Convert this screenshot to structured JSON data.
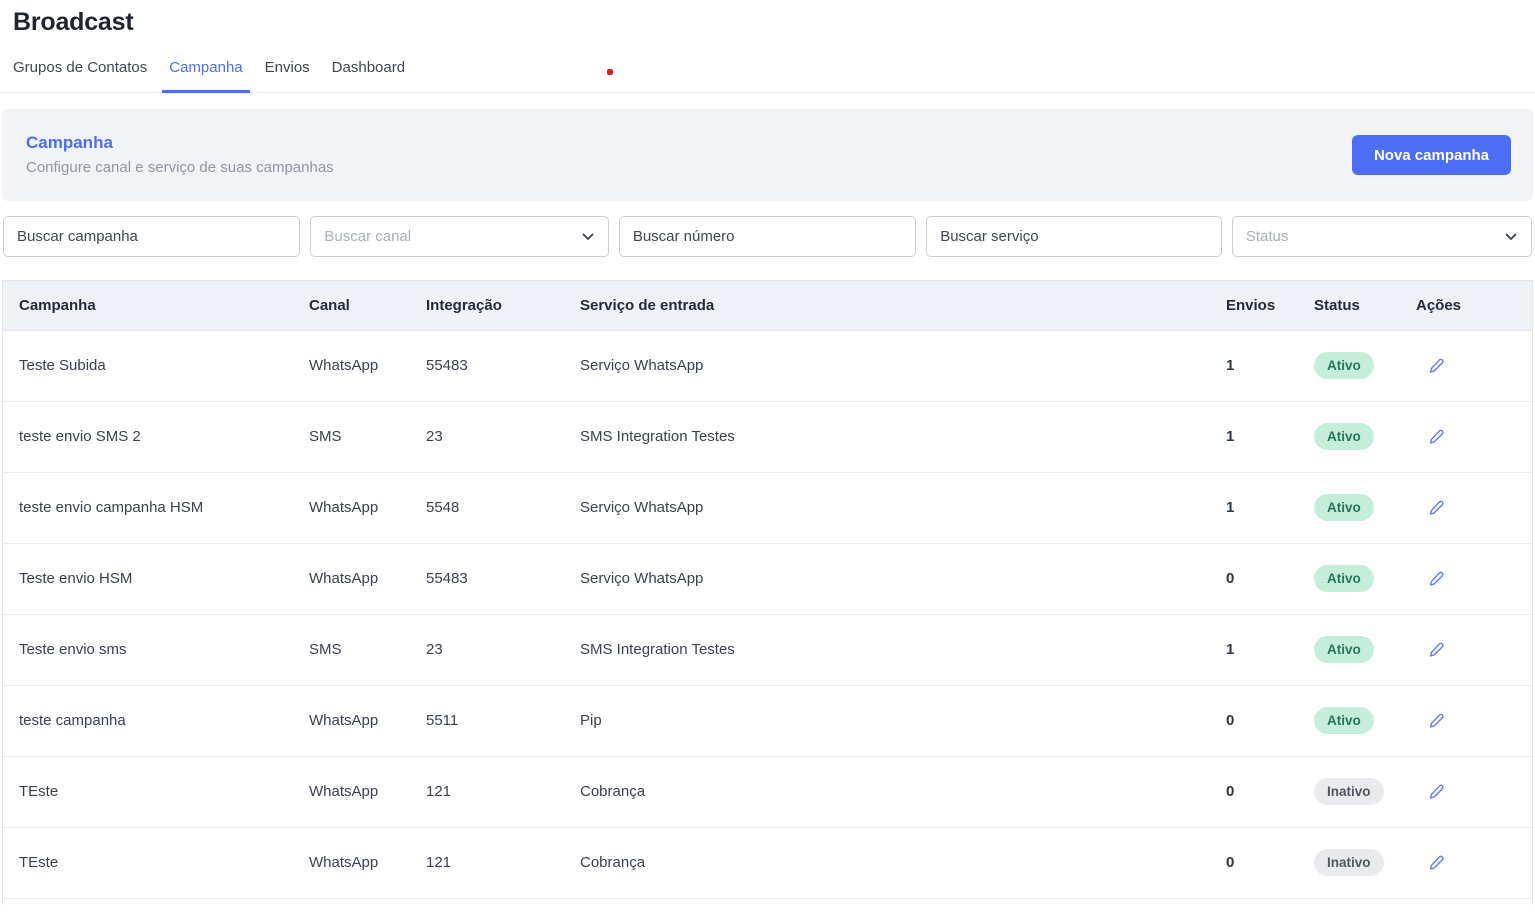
{
  "page": {
    "title": "Broadcast"
  },
  "tabs": [
    {
      "label": "Grupos de Contatos",
      "active": false
    },
    {
      "label": "Campanha",
      "active": true
    },
    {
      "label": "Envios",
      "active": false
    },
    {
      "label": "Dashboard",
      "active": false
    }
  ],
  "panel": {
    "title": "Campanha",
    "subtitle": "Configure canal e serviço de suas campanhas",
    "new_campaign_label": "Nova campanha"
  },
  "filters": {
    "campaign_placeholder": "Buscar campanha",
    "channel_placeholder": "Buscar canal",
    "number_placeholder": "Buscar número",
    "service_placeholder": "Buscar serviço",
    "status_placeholder": "Status"
  },
  "table": {
    "columns": [
      "Campanha",
      "Canal",
      "Integração",
      "Serviço de entrada",
      "Envios",
      "Status",
      "Ações"
    ],
    "rows": [
      {
        "campanha": "Teste Subida",
        "canal": "WhatsApp",
        "integracao": "55483",
        "servico": "Serviço WhatsApp",
        "envios": "1",
        "status": "Ativo"
      },
      {
        "campanha": "teste envio SMS 2",
        "canal": "SMS",
        "integracao": "23",
        "servico": "SMS Integration Testes",
        "envios": "1",
        "status": "Ativo"
      },
      {
        "campanha": "teste envio campanha HSM",
        "canal": "WhatsApp",
        "integracao": "5548",
        "servico": "Serviço WhatsApp",
        "envios": "1",
        "status": "Ativo"
      },
      {
        "campanha": "Teste envio HSM",
        "canal": "WhatsApp",
        "integracao": "55483",
        "servico": "Serviço WhatsApp",
        "envios": "0",
        "status": "Ativo"
      },
      {
        "campanha": "Teste envio sms",
        "canal": "SMS",
        "integracao": "23",
        "servico": "SMS Integration Testes",
        "envios": "1",
        "status": "Ativo"
      },
      {
        "campanha": "teste campanha",
        "canal": "WhatsApp",
        "integracao": "5511",
        "servico": "Pip",
        "envios": "0",
        "status": "Ativo"
      },
      {
        "campanha": "TEste",
        "canal": "WhatsApp",
        "integracao": "121",
        "servico": "Cobrança",
        "envios": "0",
        "status": "Inativo"
      },
      {
        "campanha": "TEste",
        "canal": "WhatsApp",
        "integracao": "121",
        "servico": "Cobrança",
        "envios": "0",
        "status": "Inativo"
      }
    ]
  },
  "colors": {
    "accent": "#4c6ef5",
    "active_badge_bg": "#c4edda",
    "active_badge_text": "#27765a",
    "inactive_badge_bg": "#e9eaed",
    "inactive_badge_text": "#4f5660",
    "marker_dot": "#d92525"
  }
}
